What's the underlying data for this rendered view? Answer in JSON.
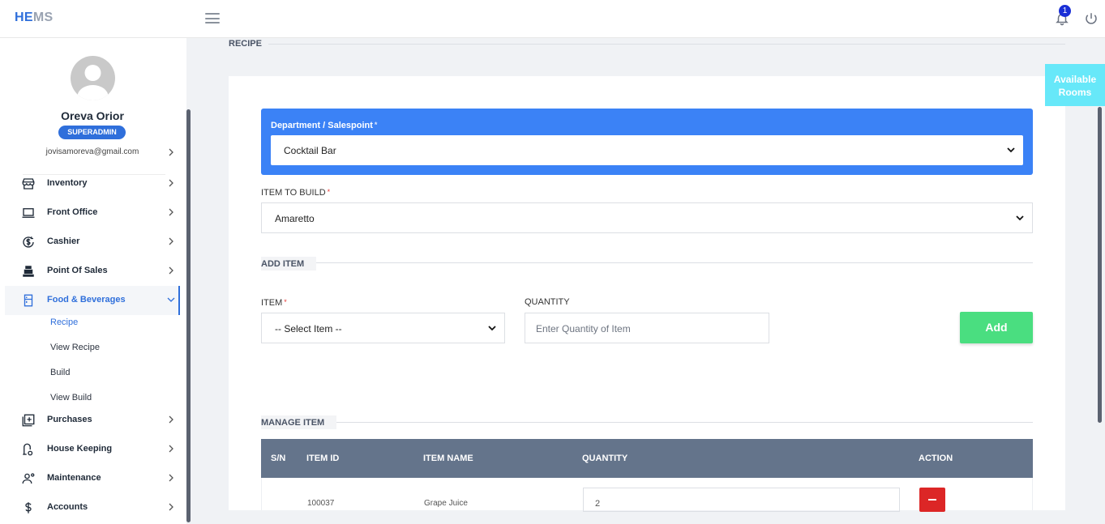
{
  "app": {
    "brand_he": "HE",
    "brand_ms": "MS"
  },
  "header": {
    "notification_count": "1"
  },
  "user": {
    "name": "Oreva Orior",
    "role": "SUPERADMIN",
    "email": "jovisamoreva@gmail.com"
  },
  "sidebar": {
    "items": [
      {
        "label": "Inventory",
        "icon": "store-icon"
      },
      {
        "label": "Front Office",
        "icon": "laptop-icon"
      },
      {
        "label": "Cashier",
        "icon": "dollar-cycle-icon"
      },
      {
        "label": "Point Of Sales",
        "icon": "cash-register-icon"
      },
      {
        "label": "Food & Beverages",
        "icon": "fridge-icon"
      },
      {
        "label": "Purchases",
        "icon": "add-box-icon"
      },
      {
        "label": "House Keeping",
        "icon": "vacuum-icon"
      },
      {
        "label": "Maintenance",
        "icon": "worker-icon"
      },
      {
        "label": "Accounts",
        "icon": "dollar-icon"
      }
    ],
    "sub_items": [
      "Recipe",
      "View Recipe",
      "Build",
      "View Build"
    ]
  },
  "page": {
    "section_title": "RECIPE",
    "dept_label": "Department / Salespoint",
    "dept_value": "Cocktail Bar",
    "item_to_build_label": "ITEM TO BUILD",
    "item_to_build_value": "Amaretto",
    "add_item_title": "ADD ITEM",
    "item_label": "ITEM",
    "item_placeholder": "-- Select Item --",
    "quantity_label": "QUANTITY",
    "quantity_placeholder": "Enter Quantity of Item",
    "add_button": "Add",
    "manage_item_title": "MANAGE ITEM",
    "required_mark": "*"
  },
  "table": {
    "headers": [
      "S/N",
      "ITEM ID",
      "ITEM NAME",
      "QUANTITY",
      "ACTION"
    ],
    "rows": [
      {
        "sn": "",
        "item_id": "100037",
        "item_name": "Grape Juice",
        "quantity": "2"
      }
    ]
  },
  "available_rooms": {
    "line1": "Available",
    "line2": "Rooms"
  },
  "colors": {
    "brand_blue": "#2f6fdb",
    "dept_panel": "#3b82f6",
    "add_button": "#4ade80",
    "delete_button": "#dc2626",
    "table_header": "#64748b",
    "available_rooms": "#67e8f9"
  }
}
